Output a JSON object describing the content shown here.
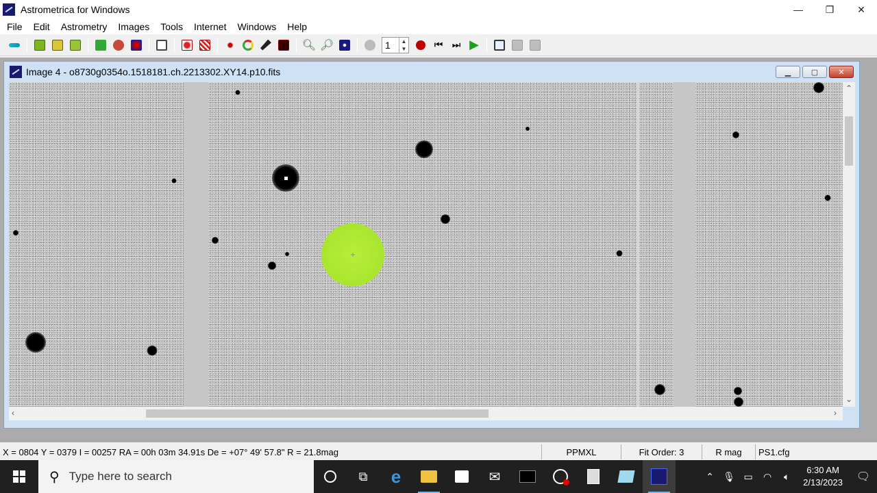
{
  "app": {
    "title": "Astrometrica for Windows",
    "icon": "astrometrica-app-icon",
    "window_controls": {
      "minimize": "—",
      "maximize": "❐",
      "close": "✕"
    }
  },
  "menu": [
    "File",
    "Edit",
    "Astrometry",
    "Images",
    "Tools",
    "Internet",
    "Windows",
    "Help"
  ],
  "toolbar": {
    "frame_number": "1",
    "colors": {
      "accent_green": "#1aa31a",
      "record_red": "#c00000"
    }
  },
  "image_window": {
    "title": "Image 4 - o8730g0354o.1518181.ch.2213302.XY14.p10.fits",
    "target_color": "#aee63a"
  },
  "status": {
    "coords": "X = 0804   Y = 0379   I = 00257    RA = 00h 03m 34.91s    De = +07° 49' 57.8\"    R = 21.8mag",
    "catalog": "PPMXL",
    "fit_order": "Fit Order: 3",
    "mag_band": "R mag",
    "config": "PS1.cfg"
  },
  "taskbar": {
    "search_placeholder": "Type here to search",
    "time": "6:30 AM",
    "date": "2/13/2023"
  }
}
